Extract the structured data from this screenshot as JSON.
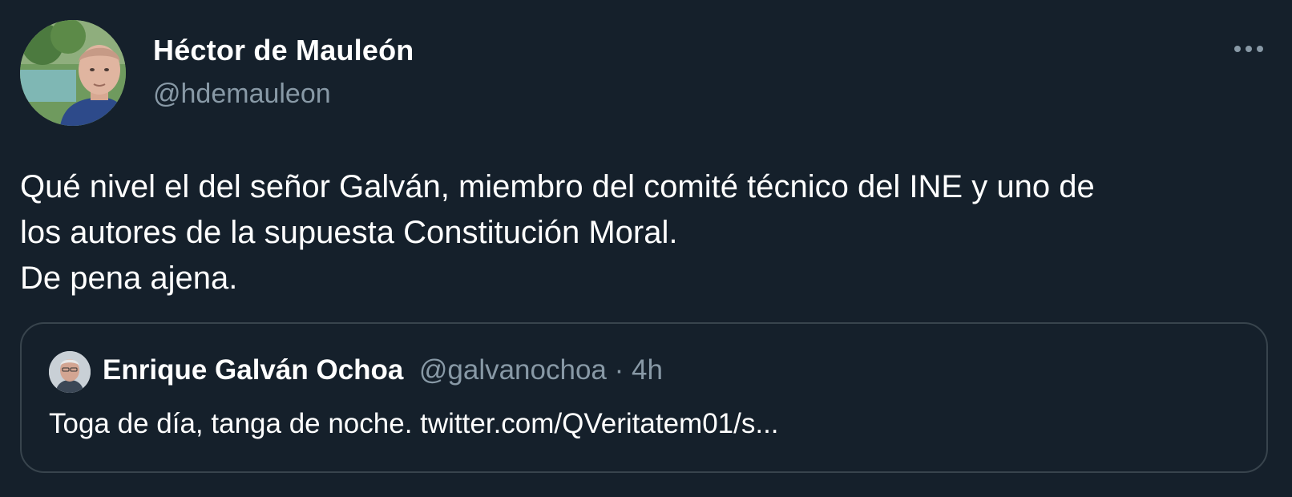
{
  "author": {
    "name": "Héctor de Mauleón",
    "handle": "@hdemauleon"
  },
  "tweet": {
    "lines": [
      "Qué nivel el del señor Galván, miembro del comité técnico del INE y uno de",
      "los autores de la supuesta Constitución Moral.",
      "De pena ajena."
    ]
  },
  "quoted_tweet": {
    "name": "Enrique Galván Ochoa",
    "handle": "@galvanochoa",
    "separator": " · ",
    "time": "4h",
    "text": "Toga de día, tanga de noche. twitter.com/QVeritatem01/s..."
  },
  "icons": {
    "more": "more-horizontal-icon",
    "author_avatar": "avatar",
    "quoted_avatar": "avatar"
  },
  "colors": {
    "background": "#15202b",
    "primary_text": "#ffffff",
    "secondary_text": "#8899a6",
    "border": "#38444d"
  }
}
